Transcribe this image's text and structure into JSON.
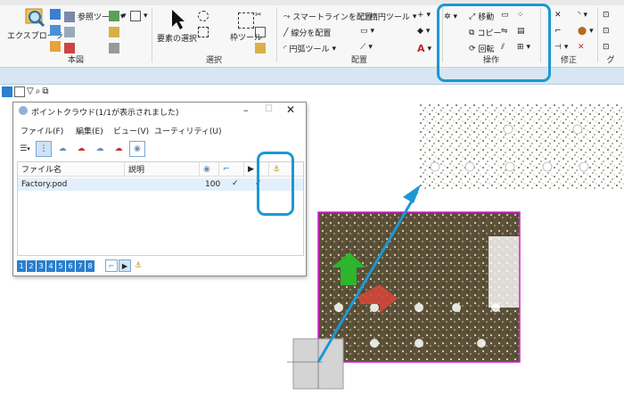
{
  "ribbon": {
    "groups": [
      {
        "label": "本図"
      },
      {
        "label": "選択"
      },
      {
        "label": "配置"
      },
      {
        "label": "操作"
      },
      {
        "label": "修正"
      },
      {
        "label": "グ"
      }
    ],
    "explorer_label": "エクスプローラ",
    "reference_tool": "参照ツール",
    "element_select": "要素の選択",
    "frame_tool": "枠ツール",
    "smartline": "スマートラインを配置",
    "line_segment": "線分を配置",
    "arc_tool": "円弧ツール",
    "ellipse_tool": "楕円ツール",
    "move": "移動",
    "copy": "コピー",
    "rotate": "回転"
  },
  "dialog": {
    "title": "ポイントクラウド(1/1が表示されました)",
    "menu": [
      "ファイル(F)",
      "編集(E)",
      "ビュー(V)",
      "ユーティリティ(U)"
    ],
    "columns": {
      "filename": "ファイル名",
      "description": "説明"
    },
    "row": {
      "filename": "Factory.pod",
      "value": "100",
      "check1": "✓",
      "check2": "✓"
    },
    "views": [
      "1",
      "2",
      "3",
      "4",
      "5",
      "6",
      "7",
      "8"
    ]
  },
  "colors": {
    "callout": "#1b98d4",
    "magenta": "#d11bd1",
    "selection": "#e3f0fb"
  }
}
